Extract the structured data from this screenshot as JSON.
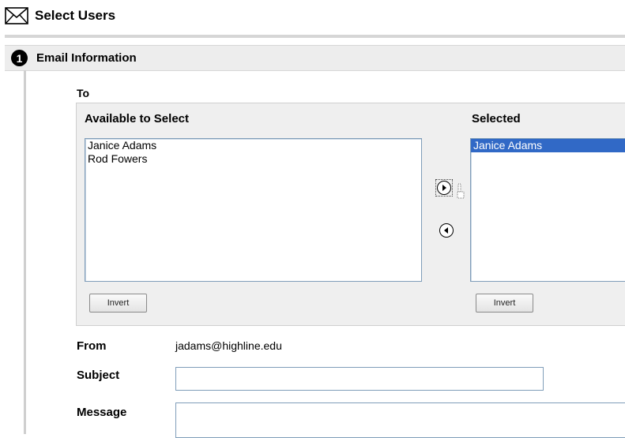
{
  "header": {
    "title": "Select Users",
    "icon": "envelope-icon"
  },
  "step": {
    "number": "1",
    "title": "Email Information"
  },
  "to": {
    "label": "To",
    "available": {
      "heading": "Available to Select",
      "items": [
        "Janice Adams",
        "Rod Fowers"
      ],
      "invert_label": "Invert"
    },
    "selected": {
      "heading": "Selected",
      "items": [
        "Janice Adams"
      ],
      "invert_label": "Invert"
    },
    "move_right_icon": "arrow-right-circle-icon",
    "move_left_icon": "arrow-left-circle-icon"
  },
  "from": {
    "label": "From",
    "value": "jadams@highline.edu"
  },
  "subject": {
    "label": "Subject",
    "value": ""
  },
  "message": {
    "label": "Message",
    "value": ""
  },
  "colors": {
    "selection": "#3169c6",
    "panel": "#efefef",
    "header_bar": "#ededed",
    "input_border": "#7f9db9"
  }
}
